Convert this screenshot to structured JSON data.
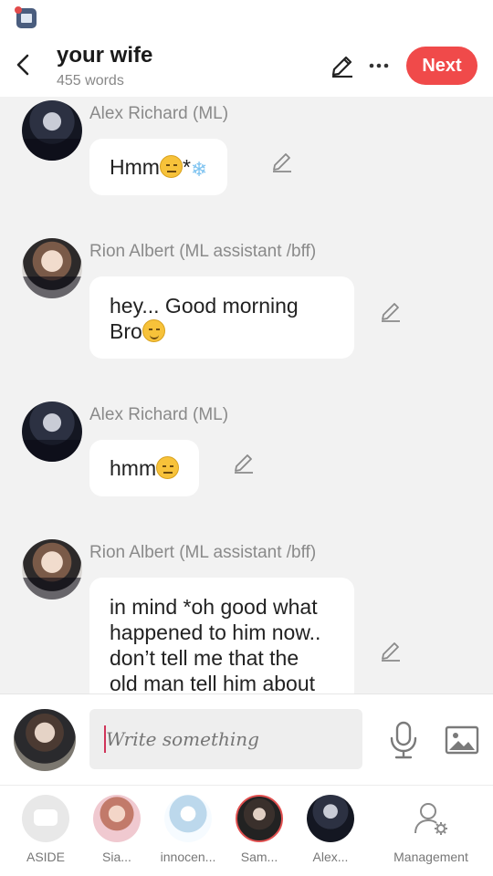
{
  "header": {
    "title": "your wife",
    "word_count": "455 words",
    "next_label": "Next"
  },
  "messages": [
    {
      "speaker": "Alex Richard  (ML)",
      "text": "Hmm",
      "suffix": "*"
    },
    {
      "speaker": "Rion Albert  (ML assistant /bff)",
      "line1": "hey...  Good morning",
      "line2": "Bro"
    },
    {
      "speaker": "Alex Richard  (ML)",
      "text": "hmm"
    },
    {
      "speaker": "Rion Albert  (ML assistant /bff)",
      "line1": "in mind *oh good what",
      "line2": "happened to him now..",
      "line3": "don’t tell me that the",
      "line4": "old man tell him about"
    }
  ],
  "composer": {
    "placeholder": "Write something"
  },
  "cast": [
    {
      "label": "ASIDE"
    },
    {
      "label": "Sia..."
    },
    {
      "label": "innocen..."
    },
    {
      "label": "Sam..."
    },
    {
      "label": "Alex..."
    },
    {
      "label": "Management"
    }
  ],
  "colors": {
    "accent": "#f04a4a",
    "background": "#f2f2f2"
  },
  "icons": [
    "app-icon",
    "back-chevron-icon",
    "pencil-icon",
    "more-dots-icon",
    "microphone-icon",
    "image-icon",
    "person-gear-icon"
  ]
}
